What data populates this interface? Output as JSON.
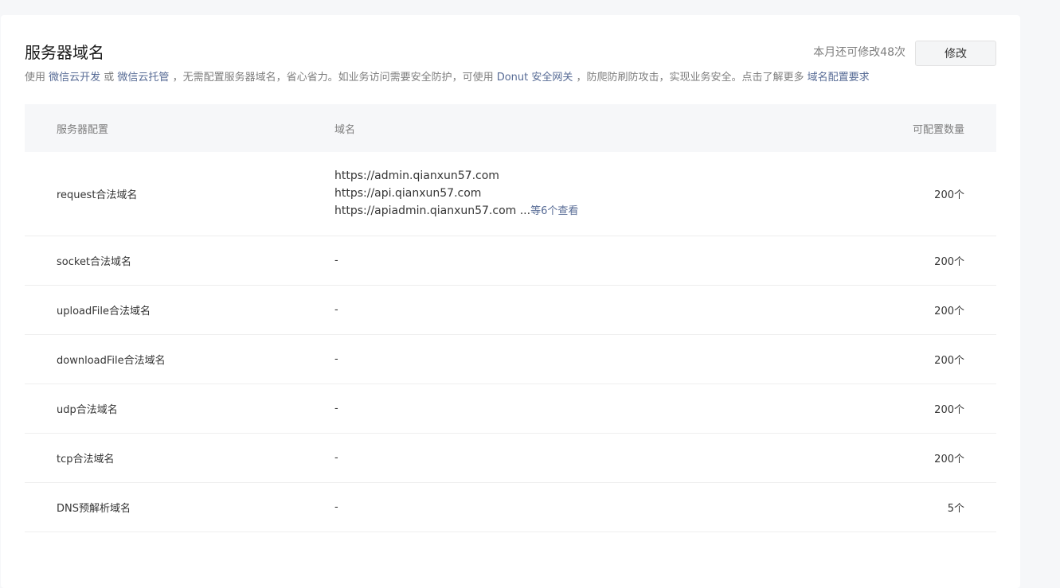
{
  "header": {
    "title": "服务器域名",
    "quota_text": "本月还可修改48次",
    "edit_label": "修改"
  },
  "description": {
    "p1": "使用 ",
    "link1": "微信云开发",
    "p2": " 或 ",
    "link2": "微信云托管",
    "p3": " ，无需配置服务器域名，省心省力。如业务访问需要安全防护，可使用 ",
    "link3": "Donut 安全网关",
    "p4": " ，防爬防刷防攻击，实现业务安全。点击了解更多 ",
    "link4": "域名配置要求"
  },
  "table": {
    "headers": {
      "config": "服务器配置",
      "domain": "域名",
      "count": "可配置数量"
    },
    "request_row": {
      "name": "request合法域名",
      "domains": [
        "https://admin.qianxun57.com",
        "https://api.qianxun57.com",
        "https://apiadmin.qianxun57.com"
      ],
      "more_prefix": " ...",
      "more_link": "等6个查看",
      "count": "200个"
    },
    "rows": [
      {
        "name": "socket合法域名",
        "domain": "-",
        "count": "200个"
      },
      {
        "name": "uploadFile合法域名",
        "domain": "-",
        "count": "200个"
      },
      {
        "name": "downloadFile合法域名",
        "domain": "-",
        "count": "200个"
      },
      {
        "name": "udp合法域名",
        "domain": "-",
        "count": "200个"
      },
      {
        "name": "tcp合法域名",
        "domain": "-",
        "count": "200个"
      },
      {
        "name": "DNS预解析域名",
        "domain": "-",
        "count": "5个"
      }
    ]
  }
}
